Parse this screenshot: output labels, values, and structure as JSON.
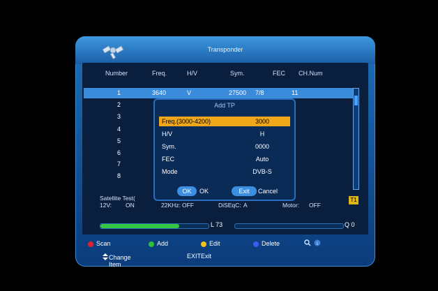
{
  "window": {
    "title": "Transponder"
  },
  "columns": [
    "Number",
    "Freq.",
    "H/V",
    "Sym.",
    "FEC",
    "CH.Num"
  ],
  "rows": [
    {
      "number": "1",
      "freq": "3640",
      "hv": "V",
      "sym": "27500",
      "fec": "7/8",
      "chnum": "11"
    },
    {
      "number": "2"
    },
    {
      "number": "3"
    },
    {
      "number": "4"
    },
    {
      "number": "5"
    },
    {
      "number": "6"
    },
    {
      "number": "7"
    },
    {
      "number": "8"
    }
  ],
  "info": {
    "satellite_test": "Satellite Test(",
    "v12": "12V:",
    "v12_val": "ON",
    "khz": "22KHz:",
    "khz_val": "OFF",
    "diseqc": "DiSEqC:",
    "diseqc_val": "A",
    "motor": "Motor:",
    "motor_val": "OFF",
    "badge": "T1"
  },
  "signal": {
    "level_label": "L 73",
    "quality_label": "Q 0",
    "level": 0.73,
    "quality": 0.0
  },
  "footer": {
    "scan": "Scan",
    "add": "Add",
    "edit": "Edit",
    "delete": "Delete",
    "colors": {
      "red": "#e0202a",
      "green": "#2fbf3a",
      "yellow": "#f2c21a",
      "blue": "#3b5bf0"
    }
  },
  "hint": {
    "change_item": "Change Item",
    "exit": "EXITExit"
  },
  "dialog": {
    "title": "Add TP",
    "fields": [
      {
        "label": "Freq.(3000-4200)",
        "value": "3000"
      },
      {
        "label": "H/V",
        "value": "H"
      },
      {
        "label": "Sym.",
        "value": "0000"
      },
      {
        "label": "FEC",
        "value": "Auto"
      },
      {
        "label": "Mode",
        "value": "DVB-S"
      }
    ],
    "ok_button": "OK",
    "ok_label": "OK",
    "exit_button": "Exit",
    "exit_label": "Cancel"
  }
}
